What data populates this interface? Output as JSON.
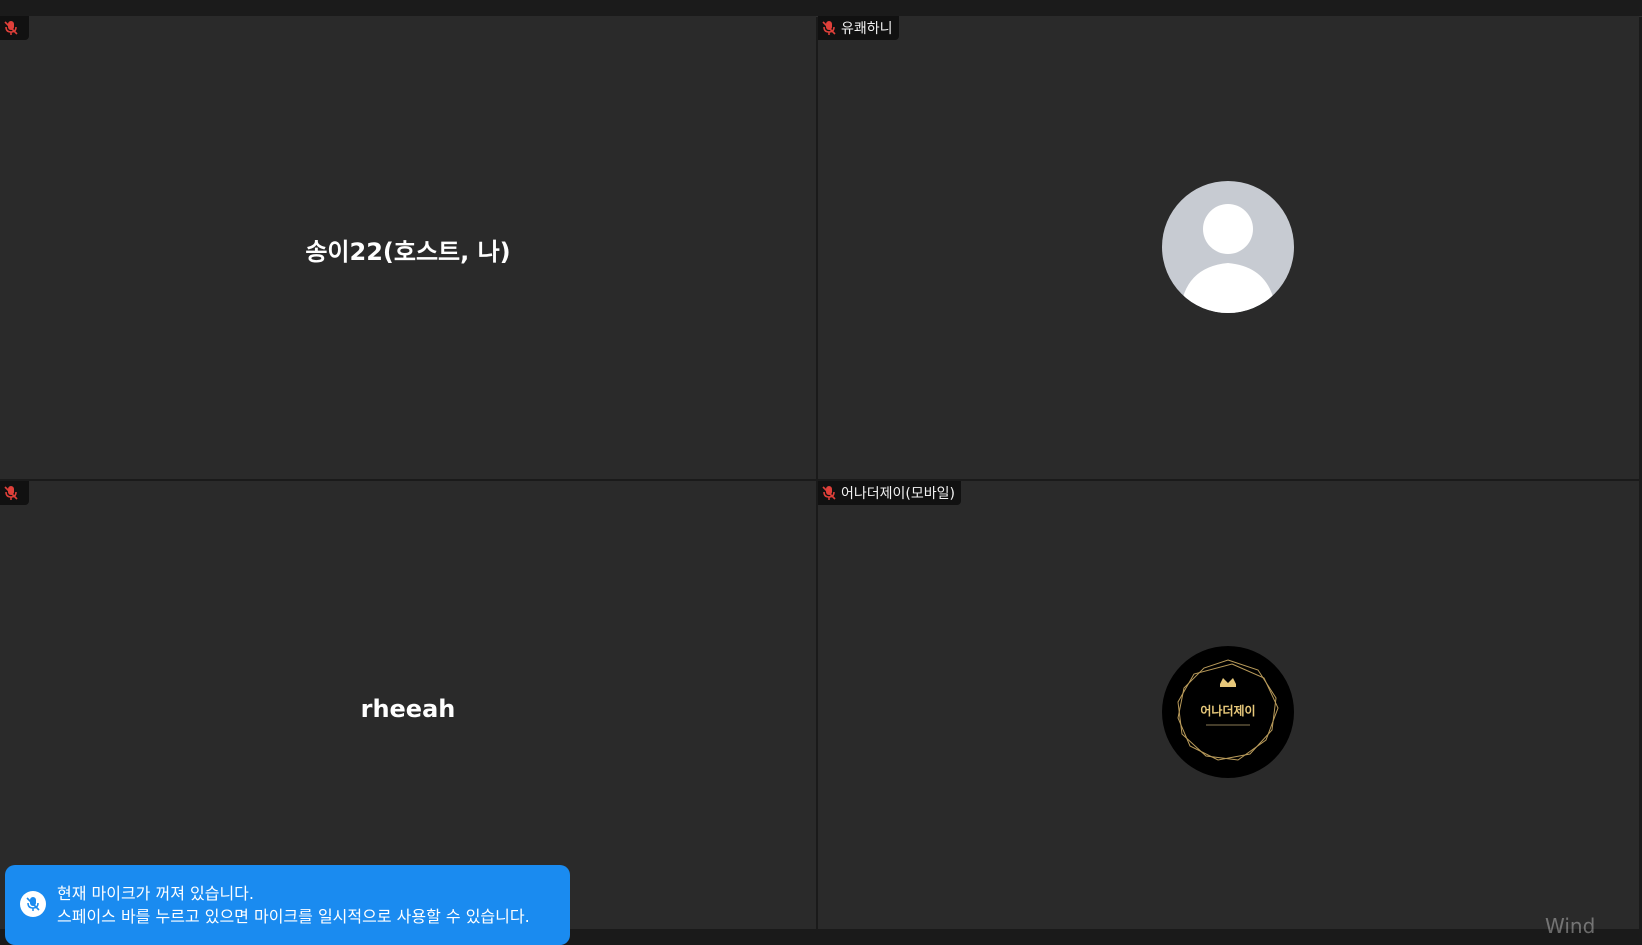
{
  "participants": [
    {
      "label": "",
      "display_name": "송이22(호스트, 나)",
      "muted": true,
      "view": "name"
    },
    {
      "label": "유쾌하니",
      "muted": true,
      "view": "avatar"
    },
    {
      "label": "",
      "display_name": "rheeah",
      "muted": true,
      "view": "name"
    },
    {
      "label": "어나더제이(모바일)",
      "muted": true,
      "view": "logo",
      "logo_text": "어나더제이"
    }
  ],
  "toast": {
    "line1": "현재 마이크가 꺼져 있습니다.",
    "line2": "스페이스 바를 누르고 있으면 마이크를 일시적으로 사용할 수 있습니다."
  },
  "watermark": "Wind",
  "colors": {
    "tile_bg": "#2a2a2a",
    "toast_bg": "#1a8bf0",
    "muted_icon": "#e0403a"
  },
  "icons": {
    "muted": "mic-off-icon",
    "avatar": "default-user-icon"
  }
}
